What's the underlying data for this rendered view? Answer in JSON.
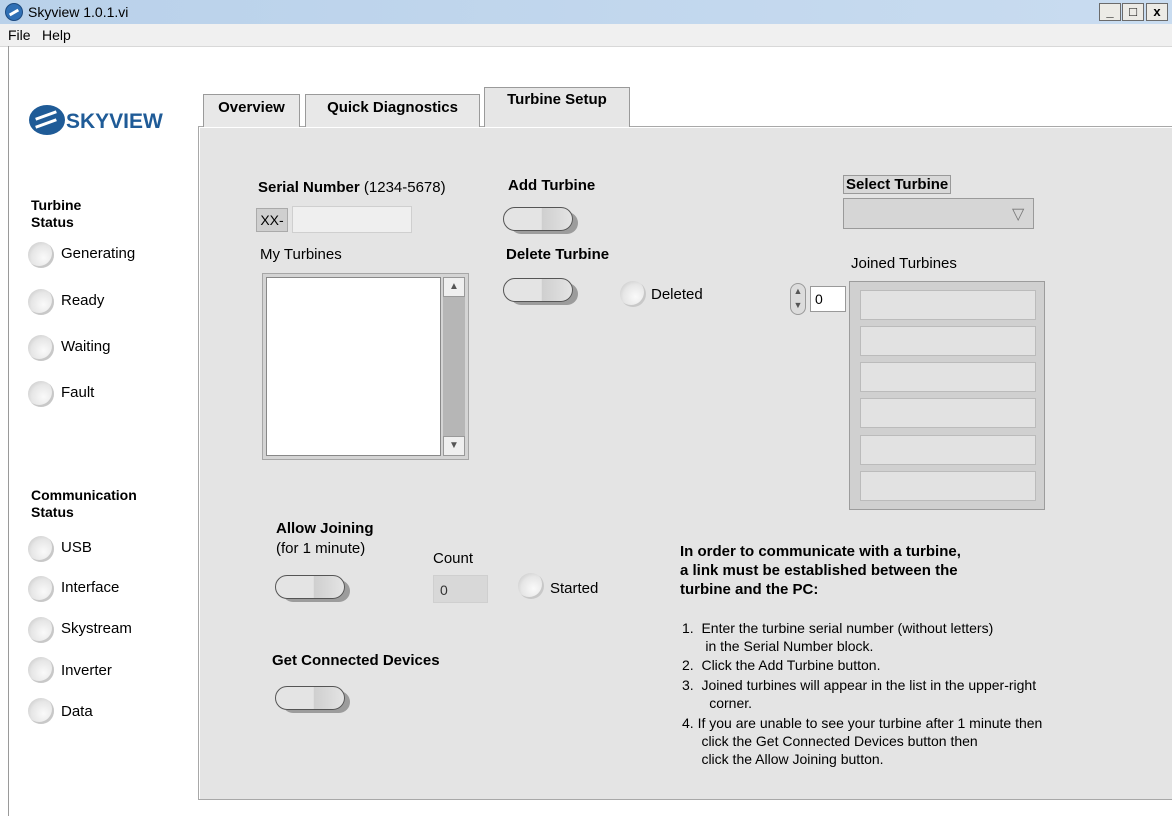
{
  "window": {
    "title": "Skyview 1.0.1.vi",
    "min": "_",
    "max": "□",
    "close": "x"
  },
  "menu": {
    "items": [
      "File",
      "Help"
    ]
  },
  "logo": {
    "text": "SKYVIEW"
  },
  "turbine_status": {
    "title": "Turbine\nStatus",
    "items": [
      "Generating",
      "Ready",
      "Waiting",
      "Fault"
    ]
  },
  "comm_status": {
    "title": "Communication\nStatus",
    "items": [
      "USB",
      "Interface",
      "Skystream",
      "Inverter",
      "Data"
    ]
  },
  "tabs": [
    "Overview",
    "Quick Diagnostics",
    "Turbine Setup"
  ],
  "setup": {
    "serial_label": "Serial Number",
    "serial_hint": "(1234-5678)",
    "serial_prefix": "XX-",
    "serial_value": "",
    "my_turbines": "My Turbines",
    "add_turbine": "Add Turbine",
    "delete_turbine": "Delete Turbine",
    "deleted": "Deleted",
    "select_turbine": "Select Turbine",
    "select_arrow": "▽",
    "joined_turbines": "Joined Turbines",
    "joined_index": "0",
    "allow_joining": "Allow Joining",
    "allow_joining_sub": "(for 1 minute)",
    "count_label": "Count",
    "count_value": "0",
    "started": "Started",
    "get_connected": "Get Connected Devices",
    "scroll_up": "▲",
    "scroll_down": "▼",
    "spin": "▲\n▼"
  },
  "instructions": {
    "heading": "In order to communicate with a turbine,\na link must be established between the\nturbine and the PC:",
    "steps": [
      "1.  Enter the turbine serial number (without letters)\n      in the Serial Number block.",
      "2.  Click the Add Turbine button.",
      "3.  Joined turbines will appear in the list in the upper-right\n       corner.",
      "4. If you are unable to see your turbine after 1 minute then\n     click the Get Connected Devices button then\n     click the Allow Joining button."
    ]
  }
}
